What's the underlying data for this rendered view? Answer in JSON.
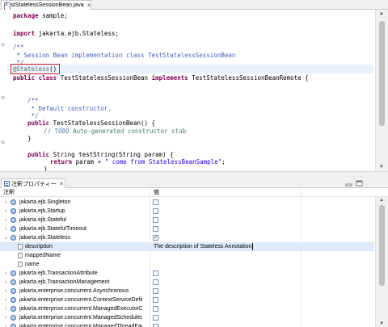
{
  "editor": {
    "tab_title": "TestStatelessSessionBean.java",
    "code": {
      "package_kw": "package",
      "package_name": " sample;",
      "import_kw": "import",
      "import_name": " jakarta.ejb.Stateless;",
      "doc1_open": "/**",
      "doc1_text": " * Session Bean implementation class TestStatelessSessionBean",
      "doc1_close": " */",
      "annotation": "@Stateless",
      "annotation_parens": "()",
      "public_kw": "public",
      "class_kw": "class",
      "class_name": " TestStatelessSessionBean ",
      "implements_kw": "implements",
      "interface_name": " TestStatelessSessionBeanRemote {",
      "doc2_open": "/**",
      "doc2_text": " * Default constructor.",
      "doc2_close": " */",
      "ctor_public_kw": "public",
      "ctor_sig": " TestStatelessSessionBean() {",
      "todo_prefix": "// ",
      "todo_kw": "TODO",
      "todo_text": " Auto-generated constructor stub",
      "ctor_close": "}",
      "method_public_kw": "public",
      "method_sig": " String testString(String param) {",
      "return_kw": "return",
      "return_expr_a": " param + ",
      "return_string": "\" come from StatelessBeanSample\"",
      "return_expr_b": ";",
      "method_close": "}"
    }
  },
  "view": {
    "tab_title": "注釈プロパティー",
    "columns": {
      "name": "注釈",
      "value": "値"
    },
    "rows": [
      {
        "label": "jakarta.ejb.Singleton",
        "checked": false
      },
      {
        "label": "jakarta.ejb.Startup",
        "checked": false
      },
      {
        "label": "jakarta.ejb.Stateful",
        "checked": false
      },
      {
        "label": "jakarta.ejb.StatefulTimeout",
        "checked": false
      },
      {
        "label": "jakarta.ejb.Stateless",
        "checked": true
      },
      {
        "label": "description",
        "value": "The description of Stateless Annotation"
      },
      {
        "label": "mappedName"
      },
      {
        "label": "name"
      },
      {
        "label": "jakarta.ejb.TransactionAttribute",
        "checked": false
      },
      {
        "label": "jakarta.ejb.TransactionManagement",
        "checked": false
      },
      {
        "label": "jakarta.enterprise.concurrent.Asynchronous",
        "checked": false
      },
      {
        "label": "jakarta.enterprise.concurrent.ContextServiceDefinition",
        "checked": false
      },
      {
        "label": "jakarta.enterprise.concurrent.ManagedExecutorDefinition",
        "checked": false
      },
      {
        "label": "jakarta.enterprise.concurrent.ManagedScheduledExecutorDefinition",
        "checked": false
      },
      {
        "label": "jakarta.enterprise.concurrent.ManagedThreadFactoryDefinition",
        "checked": false
      }
    ]
  },
  "colors": {
    "keyword": "#7f0055",
    "javadoc": "#3f5fbf",
    "comment": "#3f7f5f",
    "string": "#2a00ff",
    "annotation": "#646464",
    "selection": "#ddeafb",
    "highlight_box": "#d02020"
  }
}
